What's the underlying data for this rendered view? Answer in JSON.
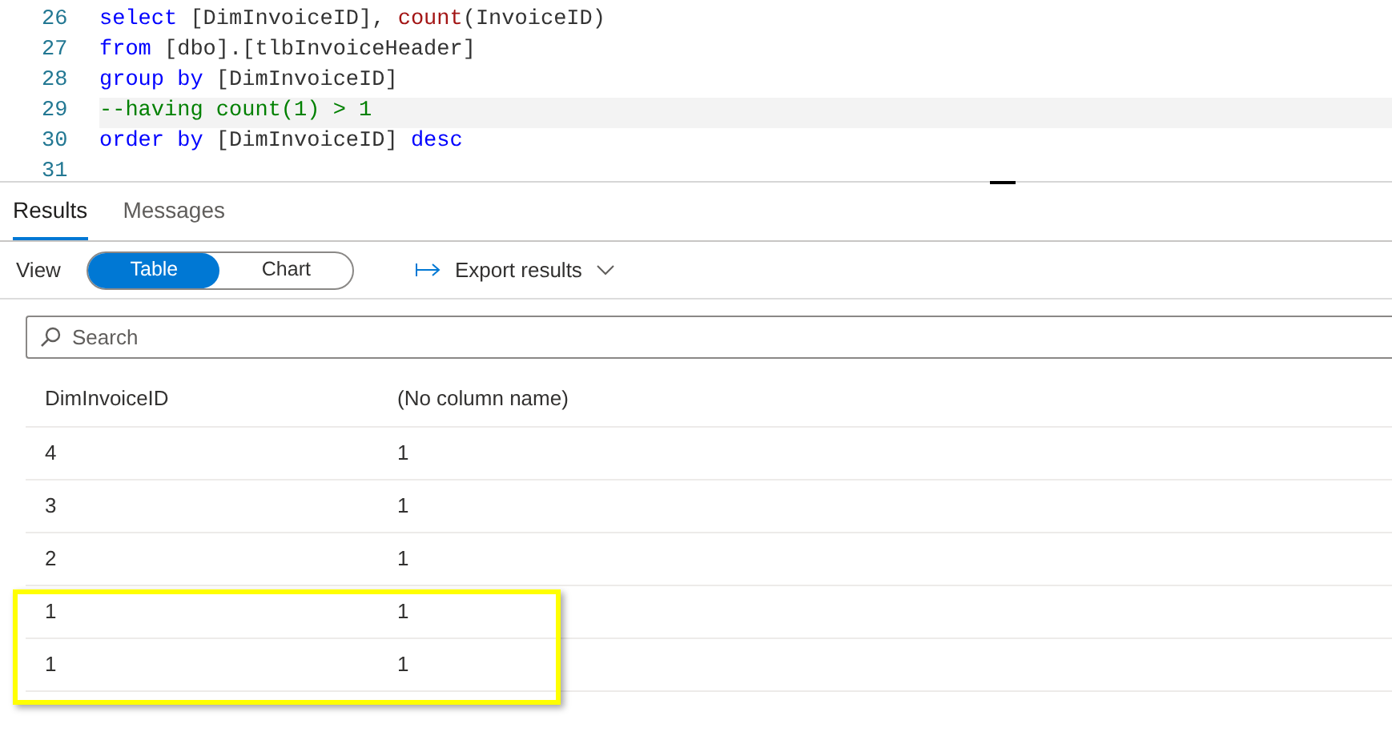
{
  "editor": {
    "lines": [
      {
        "number": "26",
        "current": false,
        "tokens": [
          {
            "kind": "keyword",
            "text": "select"
          },
          {
            "kind": "plain",
            "text": " [DimInvoiceID], "
          },
          {
            "kind": "function",
            "text": "count"
          },
          {
            "kind": "plain",
            "text": "(InvoiceID)"
          }
        ]
      },
      {
        "number": "27",
        "current": false,
        "tokens": [
          {
            "kind": "keyword",
            "text": "from"
          },
          {
            "kind": "plain",
            "text": " [dbo].[tlbInvoiceHeader]"
          }
        ]
      },
      {
        "number": "28",
        "current": false,
        "tokens": [
          {
            "kind": "keyword",
            "text": "group by"
          },
          {
            "kind": "plain",
            "text": " [DimInvoiceID]"
          }
        ]
      },
      {
        "number": "29",
        "current": true,
        "tokens": [
          {
            "kind": "comment",
            "text": "--having count(1) > 1"
          }
        ]
      },
      {
        "number": "30",
        "current": false,
        "tokens": [
          {
            "kind": "keyword",
            "text": "order by"
          },
          {
            "kind": "plain",
            "text": " [DimInvoiceID] "
          },
          {
            "kind": "keyword",
            "text": "desc"
          }
        ]
      },
      {
        "number": "31",
        "current": false
      }
    ]
  },
  "tabs": [
    {
      "label": "Results",
      "selected": true
    },
    {
      "label": "Messages",
      "selected": false
    }
  ],
  "toolbar": {
    "view_label": "View",
    "view_options": [
      {
        "label": "Table",
        "selected": true
      },
      {
        "label": "Chart",
        "selected": false
      }
    ],
    "export": "Export results"
  },
  "search": {
    "placeholder": "Search"
  },
  "table": {
    "columns": [
      "DimInvoiceID",
      "(No column name)"
    ],
    "rows": [
      {
        "cells": [
          "4",
          "1"
        ],
        "highlighted": false
      },
      {
        "cells": [
          "3",
          "1"
        ],
        "highlighted": false
      },
      {
        "cells": [
          "2",
          "1"
        ],
        "highlighted": false
      },
      {
        "cells": [
          "1",
          "1"
        ],
        "highlighted": true
      },
      {
        "cells": [
          "1",
          "1"
        ],
        "highlighted": true
      }
    ]
  }
}
